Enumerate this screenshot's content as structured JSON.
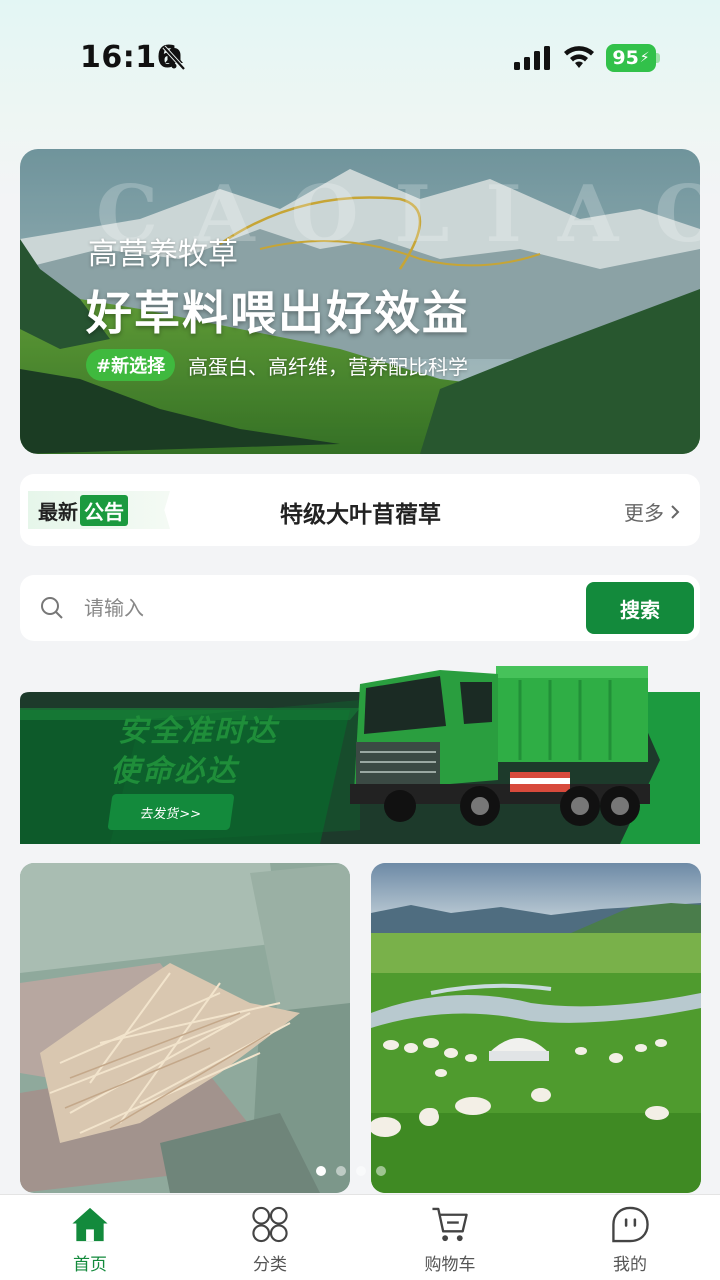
{
  "status_bar": {
    "time": "16:16",
    "battery": "95"
  },
  "hero": {
    "watermark": "CAOLIAO",
    "subtitle": "高营养牧草",
    "title": "好草料喂出好效益",
    "tag": "#新选择",
    "description": "高蛋白、高纤维，营养配比科学"
  },
  "notice": {
    "badge_part1": "最新",
    "badge_part2": "公告",
    "title": "特级大叶苜蓿草",
    "more": "更多"
  },
  "search": {
    "placeholder": "请输入",
    "button": "搜索"
  },
  "truck_banner": {
    "slogan_line1": "安全准时达",
    "slogan_line2": "使命必达",
    "button": "去发货>>"
  },
  "carousel": {
    "dots_count": 4,
    "active_index": 0
  },
  "tabbar": {
    "items": [
      {
        "label": "首页",
        "icon": "home-icon",
        "active": true
      },
      {
        "label": "分类",
        "icon": "category-icon",
        "active": false
      },
      {
        "label": "购物车",
        "icon": "cart-icon",
        "active": false
      },
      {
        "label": "我的",
        "icon": "profile-icon",
        "active": false
      }
    ]
  },
  "colors": {
    "brand_green": "#138a3c",
    "tag_green": "#3fb93e"
  }
}
